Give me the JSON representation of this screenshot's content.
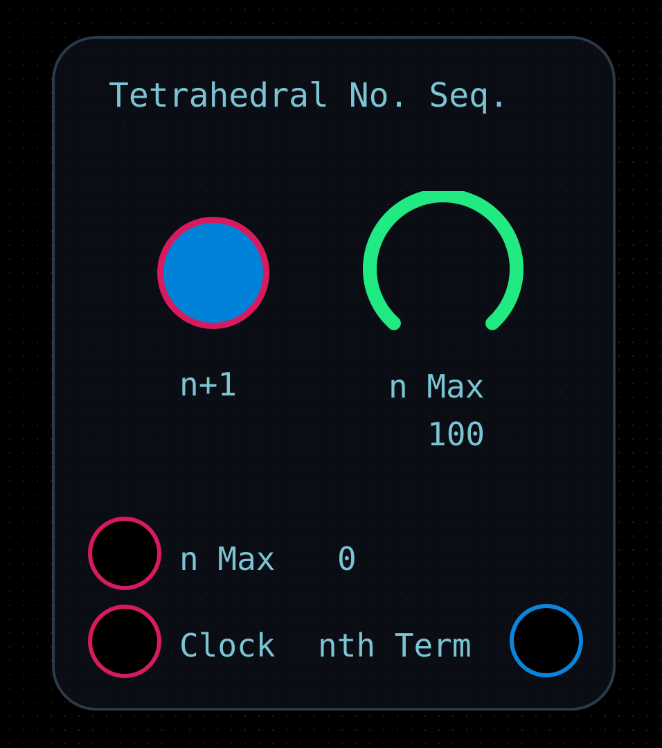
{
  "module": {
    "title": "Tetrahedral No. Seq."
  },
  "controls": {
    "advance_button": {
      "label": "n+1",
      "colors": {
        "fill": "#0082d8",
        "ring": "#d81b5e"
      }
    },
    "n_max_knob": {
      "label": "n Max",
      "value": "100",
      "arc_color": "#22ea82"
    }
  },
  "ports": {
    "n_max_input": {
      "label": "n Max",
      "value": "0",
      "ring_color": "#d81b5e"
    },
    "clock_input": {
      "label": "Clock",
      "ring_color": "#d81b5e"
    },
    "nth_term_output": {
      "label": "nth Term",
      "ring_color": "#0a84dc"
    }
  },
  "colors": {
    "text": "#7cc4d4",
    "panel_background": "#0a0e14",
    "panel_border": "#2a3a48"
  }
}
